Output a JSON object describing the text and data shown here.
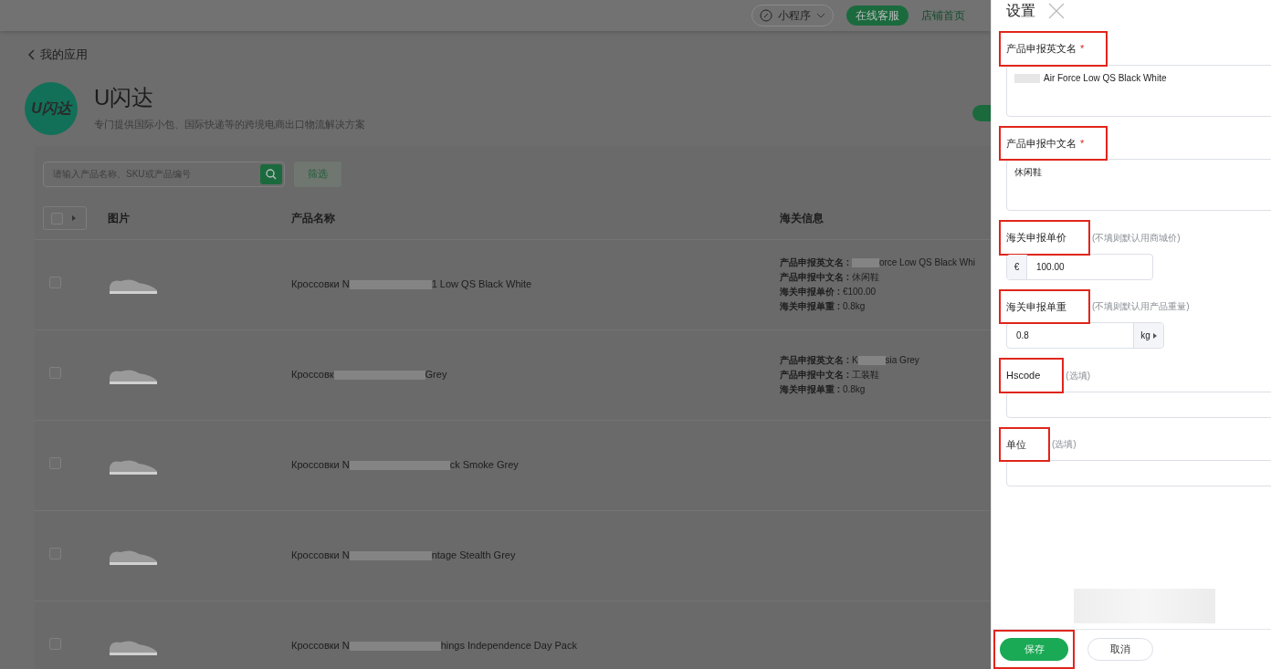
{
  "header": {
    "miniprogram": {
      "label": "小程序"
    },
    "service_button": "在线客服",
    "store_link": "店铺首页"
  },
  "back_link": "我的应用",
  "app": {
    "logo": "U闪达",
    "title": "U闪达",
    "subtitle": "专门提供国际小包、国际快递等的跨境电商出口物流解决方案",
    "toggle": {
      "on": true
    }
  },
  "search": {
    "placeholder": "请输入产品名称、SKU或产品编号"
  },
  "filter_button": "筛选",
  "table": {
    "columns": [
      "图片",
      "产品名称",
      "海关信息"
    ],
    "rows": [
      {
        "checked": false,
        "name_parts": [
          "Кроссовки N",
          "1 Low QS Black White"
        ],
        "customs": [
          {
            "label": "产品申报英文名 : ",
            "leading_redaction": true,
            "value_parts": [
              "orce Low QS Black Whi"
            ]
          },
          {
            "label": "产品申报中文名 : ",
            "value_parts": [
              "休闲鞋"
            ]
          },
          {
            "label": "海关申报单价 : ",
            "value_parts": [
              "€100.00"
            ]
          },
          {
            "label": "海关申报单重 : ",
            "value_parts": [
              "0.8kg"
            ]
          }
        ]
      },
      {
        "checked": false,
        "name_parts": [
          "Кроссовк",
          "Grey"
        ],
        "customs": [
          {
            "label": "产品申报英文名 : ",
            "value_parts": [
              "K",
              "sia Grey"
            ]
          },
          {
            "label": "产品申报中文名 : ",
            "value_parts": [
              "工装鞋"
            ]
          },
          {
            "label": "海关申报单重 : ",
            "value_parts": [
              "0.8kg"
            ]
          }
        ]
      },
      {
        "checked": false,
        "name_parts": [
          "Кроссовки N",
          "ck Smoke Grey"
        ],
        "customs": []
      },
      {
        "checked": false,
        "name_parts": [
          "Кроссовки N",
          "ntage Stealth Grey"
        ],
        "customs": []
      },
      {
        "checked": false,
        "name_parts": [
          "Кроссовки N",
          "hings Independence Day Pack"
        ],
        "customs": []
      }
    ]
  },
  "drawer": {
    "title": "设置",
    "fields": [
      {
        "kind": "textarea",
        "label": "产品申报英文名",
        "required_mark": "*",
        "highlighted": true,
        "leading_redaction": true,
        "value": "Air Force  Low QS Black White"
      },
      {
        "kind": "textarea",
        "label": "产品申报中文名",
        "required_mark": "*",
        "highlighted": true,
        "value": "休闲鞋"
      },
      {
        "kind": "prefix",
        "label": "海关申报单价",
        "hint": "(不填则默认用商城价)",
        "highlighted": true,
        "prefix": "€",
        "value": "100.00"
      },
      {
        "kind": "suffix",
        "label": "海关申报单重",
        "hint": "(不填则默认用产品重量)",
        "highlighted": true,
        "suffix": "kg",
        "value": "0.8"
      },
      {
        "kind": "input",
        "label": "Hscode",
        "hint": "(选填)",
        "highlighted": true
      },
      {
        "kind": "input",
        "label": "单位",
        "hint": "(选填)",
        "highlighted": true
      }
    ],
    "buttons": [
      {
        "label": "保存",
        "kind": "primary",
        "highlighted": true
      },
      {
        "label": "取消",
        "kind": "secondary",
        "highlighted": false
      }
    ]
  }
}
